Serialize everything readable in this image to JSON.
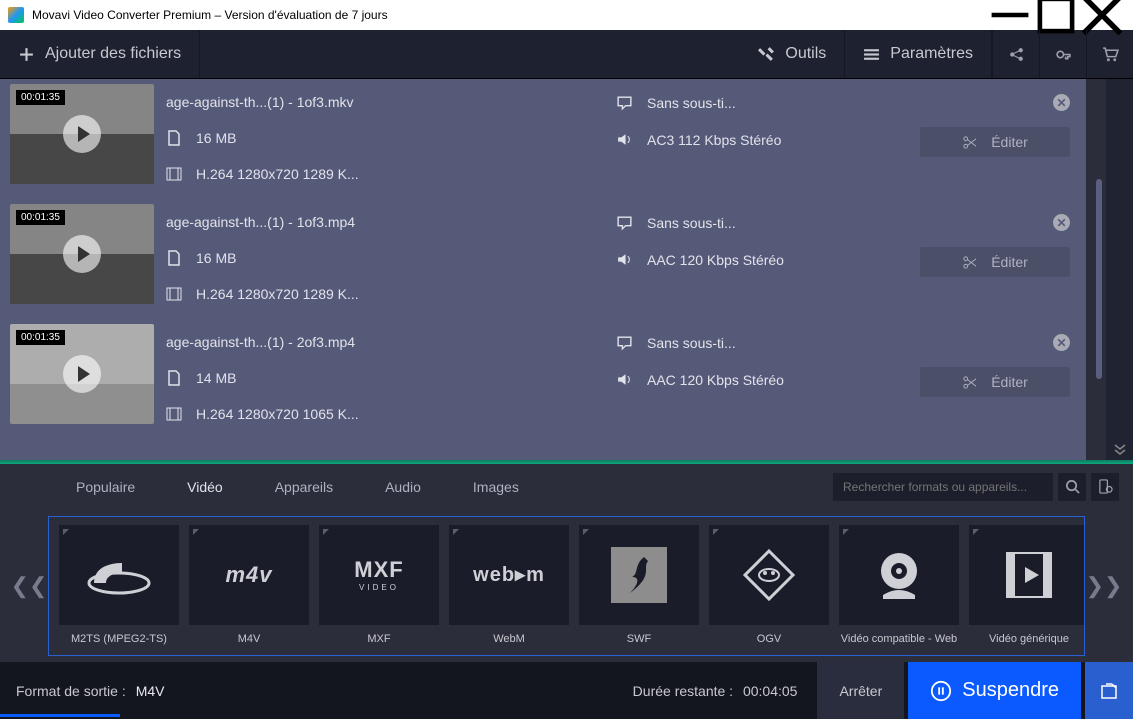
{
  "titlebar": {
    "title": "Movavi Video Converter Premium – Version d'évaluation de 7 jours"
  },
  "toolbar": {
    "add_files": "Ajouter des fichiers",
    "tools": "Outils",
    "settings": "Paramètres"
  },
  "files": [
    {
      "duration": "00:01:35",
      "name": "age-against-th...(1) - 1of3.mkv",
      "size": "16 MB",
      "codec": "H.264 1280x720 1289 K...",
      "subs": "Sans sous-ti...",
      "audio": "AC3 112 Kbps Stéréo",
      "edit": "Éditer"
    },
    {
      "duration": "00:01:35",
      "name": "age-against-th...(1) - 1of3.mp4",
      "size": "16 MB",
      "codec": "H.264 1280x720 1289 K...",
      "subs": "Sans sous-ti...",
      "audio": "AAC 120 Kbps Stéréo",
      "edit": "Éditer"
    },
    {
      "duration": "00:01:35",
      "name": "age-against-th...(1) - 2of3.mp4",
      "size": "14 MB",
      "codec": "H.264 1280x720 1065 K...",
      "subs": "Sans sous-ti...",
      "audio": "AAC 120 Kbps Stéréo",
      "edit": "Éditer"
    }
  ],
  "fmt_tabs": {
    "popular": "Populaire",
    "video": "Vidéo",
    "devices": "Appareils",
    "audio": "Audio",
    "images": "Images"
  },
  "search": {
    "placeholder": "Rechercher formats ou appareils..."
  },
  "formats": [
    {
      "label": "M2TS (MPEG2-TS)"
    },
    {
      "label": "M4V"
    },
    {
      "label": "MXF"
    },
    {
      "label": "WebM"
    },
    {
      "label": "SWF"
    },
    {
      "label": "OGV"
    },
    {
      "label": "Vidéo compatible - Web"
    },
    {
      "label": "Vidéo générique"
    }
  ],
  "bottom": {
    "output_label": "Format de sortie :",
    "output_value": "M4V",
    "remaining_label": "Durée restante :",
    "remaining_value": "00:04:05",
    "abort": "Arrêter",
    "pause": "Suspendre"
  }
}
